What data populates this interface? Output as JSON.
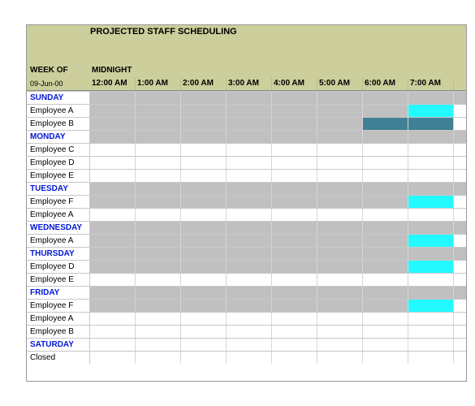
{
  "title": "PROJECTED STAFF SCHEDULING",
  "week_of_label": "WEEK OF",
  "week_of_date": "09-Jun-00",
  "midnight_label": "MIDNIGHT",
  "hours": [
    "12:00 AM",
    "1:00 AM",
    "2:00 AM",
    "3:00 AM",
    "4:00 AM",
    "5:00 AM",
    "6:00 AM",
    "7:00 AM"
  ],
  "rows": [
    {
      "type": "day",
      "label": "SUNDAY",
      "slots": [
        "gray",
        "gray",
        "gray",
        "gray",
        "gray",
        "gray",
        "gray",
        "gray"
      ]
    },
    {
      "type": "employee",
      "label": "Employee A",
      "slots": [
        "gray",
        "gray",
        "gray",
        "gray",
        "gray",
        "gray",
        "gray",
        "cyan"
      ]
    },
    {
      "type": "employee",
      "label": "Employee B",
      "slots": [
        "gray",
        "gray",
        "gray",
        "gray",
        "gray",
        "gray",
        "steel",
        "steel"
      ]
    },
    {
      "type": "day",
      "label": "MONDAY",
      "slots": [
        "gray",
        "gray",
        "gray",
        "gray",
        "gray",
        "gray",
        "gray",
        "gray"
      ]
    },
    {
      "type": "employee",
      "label": "Employee C",
      "slots": [
        "empty",
        "empty",
        "empty",
        "empty",
        "empty",
        "empty",
        "empty",
        "empty"
      ]
    },
    {
      "type": "employee",
      "label": "Employee D",
      "slots": [
        "empty",
        "empty",
        "empty",
        "empty",
        "empty",
        "empty",
        "empty",
        "empty"
      ]
    },
    {
      "type": "employee",
      "label": "Employee E",
      "slots": [
        "empty",
        "empty",
        "empty",
        "empty",
        "empty",
        "empty",
        "empty",
        "empty"
      ]
    },
    {
      "type": "day",
      "label": "TUESDAY",
      "slots": [
        "gray",
        "gray",
        "gray",
        "gray",
        "gray",
        "gray",
        "gray",
        "gray"
      ]
    },
    {
      "type": "employee",
      "label": "Employee F",
      "slots": [
        "gray",
        "gray",
        "gray",
        "gray",
        "gray",
        "gray",
        "gray",
        "cyan"
      ]
    },
    {
      "type": "employee",
      "label": "Employee A",
      "slots": [
        "empty",
        "empty",
        "empty",
        "empty",
        "empty",
        "empty",
        "empty",
        "empty"
      ]
    },
    {
      "type": "day",
      "label": "WEDNESDAY",
      "slots": [
        "gray",
        "gray",
        "gray",
        "gray",
        "gray",
        "gray",
        "gray",
        "gray"
      ]
    },
    {
      "type": "employee",
      "label": "Employee A",
      "slots": [
        "gray",
        "gray",
        "gray",
        "gray",
        "gray",
        "gray",
        "gray",
        "cyan"
      ]
    },
    {
      "type": "day",
      "label": "THURSDAY",
      "slots": [
        "gray",
        "gray",
        "gray",
        "gray",
        "gray",
        "gray",
        "gray",
        "gray"
      ]
    },
    {
      "type": "employee",
      "label": "Employee D",
      "slots": [
        "gray",
        "gray",
        "gray",
        "gray",
        "gray",
        "gray",
        "gray",
        "cyan"
      ]
    },
    {
      "type": "employee",
      "label": "Employee E",
      "slots": [
        "empty",
        "empty",
        "empty",
        "empty",
        "empty",
        "empty",
        "empty",
        "empty"
      ]
    },
    {
      "type": "day",
      "label": "FRIDAY",
      "slots": [
        "gray",
        "gray",
        "gray",
        "gray",
        "gray",
        "gray",
        "gray",
        "gray"
      ]
    },
    {
      "type": "employee",
      "label": "Employee F",
      "slots": [
        "gray",
        "gray",
        "gray",
        "gray",
        "gray",
        "gray",
        "gray",
        "cyan"
      ]
    },
    {
      "type": "employee",
      "label": "Employee A",
      "slots": [
        "empty",
        "empty",
        "empty",
        "empty",
        "empty",
        "empty",
        "empty",
        "empty"
      ]
    },
    {
      "type": "employee",
      "label": "Employee B",
      "slots": [
        "empty",
        "empty",
        "empty",
        "empty",
        "empty",
        "empty",
        "empty",
        "empty"
      ]
    },
    {
      "type": "day",
      "label": "SATURDAY",
      "slots": [
        "empty",
        "empty",
        "empty",
        "empty",
        "empty",
        "empty",
        "empty",
        "empty"
      ]
    },
    {
      "type": "closed",
      "label": "Closed",
      "slots": [
        "empty",
        "empty",
        "empty",
        "empty",
        "empty",
        "empty",
        "empty",
        "empty"
      ]
    }
  ]
}
